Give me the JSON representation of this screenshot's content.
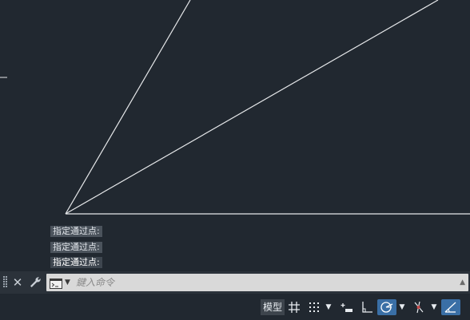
{
  "app": {
    "colors": {
      "canvas_bg": "#212830",
      "line": "#e6e8ea",
      "accent": "#3a6fa6"
    }
  },
  "command_history": [
    "指定通过点:",
    "指定通过点:",
    "指定通过点:"
  ],
  "command_line": {
    "placeholder": "鍵入命令",
    "icons": [
      "grip-icon",
      "close-icon",
      "wrench-icon",
      "command-prompt-icon",
      "chevron-down-icon",
      "scroll-up-icon"
    ]
  },
  "status_bar": {
    "model_label": "模型",
    "buttons": [
      {
        "name": "grid-display",
        "icon": "grid-icon",
        "active": false
      },
      {
        "name": "snap-mode",
        "icon": "snap-icon",
        "active": false
      },
      {
        "name": "dynamic-input",
        "icon": "dynamic-input-icon",
        "active": false
      },
      {
        "name": "ortho-mode",
        "icon": "ortho-icon",
        "active": false
      },
      {
        "name": "polar-tracking",
        "icon": "polar-icon",
        "active": true
      },
      {
        "name": "object-snap",
        "icon": "osnap-icon",
        "active": false
      },
      {
        "name": "object-snap-tracking",
        "icon": "otrack-icon",
        "active": true
      }
    ]
  }
}
